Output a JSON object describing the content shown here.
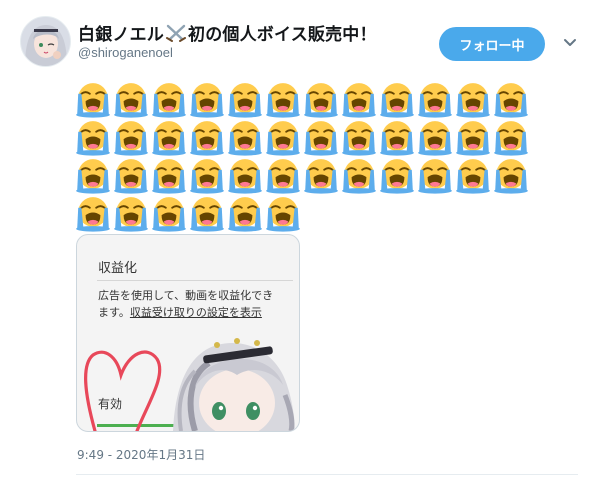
{
  "tweet": {
    "display_name_part1": "白銀ノエル",
    "display_name_part2": "初の個人ボイス販売中！",
    "handle": "@shiroganenoel",
    "follow_label": "フォロー中",
    "emoji_rows": [
      12,
      12,
      12,
      6
    ],
    "emoji_name": "loudly-crying-face",
    "timestamp": "9:49 - 2020年1月31日"
  },
  "card": {
    "title": "収益化",
    "body_text": "広告を使用して、動画を収益化できます。",
    "body_link": "収益受け取りの設定を表示",
    "status": "有効"
  },
  "colors": {
    "follow_button": "#4aa9eb",
    "handle_text": "#657786",
    "emoji_face": "#ffcc4d",
    "emoji_tears": "#5dadec",
    "heart_doodle": "#e8485a",
    "status_bar": "#4caf50"
  }
}
